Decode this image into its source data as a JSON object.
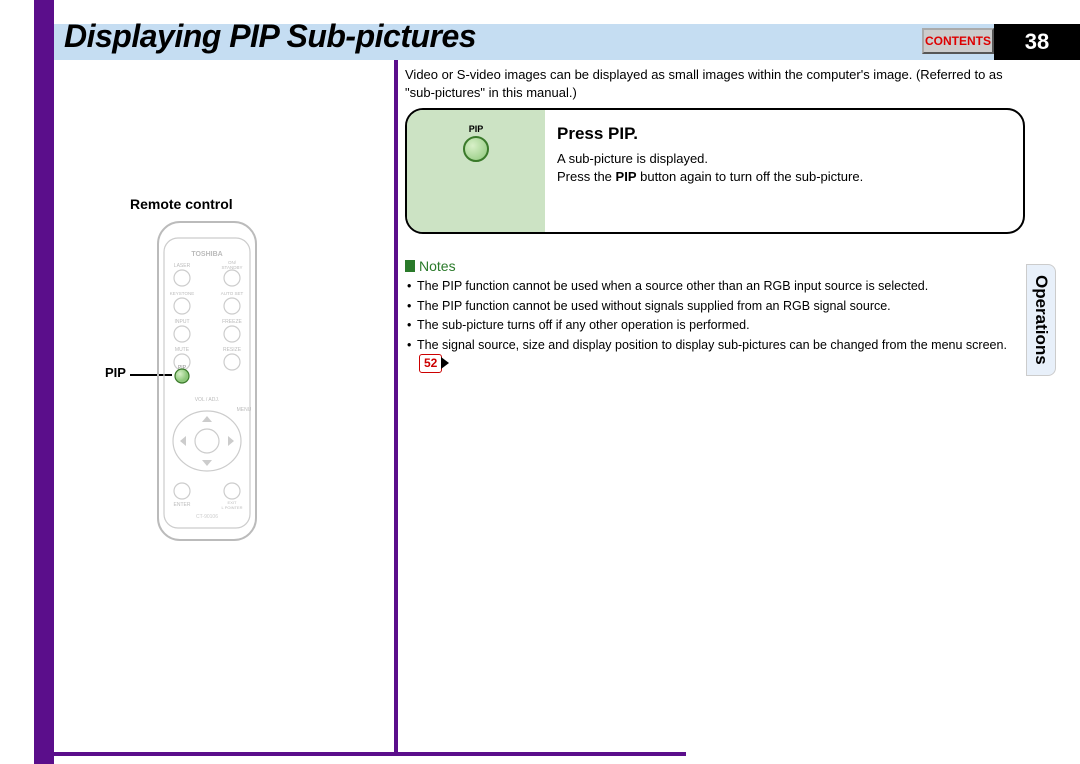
{
  "header": {
    "title": "Displaying PIP Sub-pictures",
    "contents_button": "CONTENTS",
    "page_number": "38"
  },
  "intro": "Video or S-video images can be displayed as small images within the computer's image. (Referred to as \"sub-pictures\" in this manual.)",
  "instruction": {
    "button_label": "PIP",
    "heading": "Press PIP.",
    "line1": "A sub-picture is displayed.",
    "line2_pre": "Press the ",
    "line2_bold": "PIP",
    "line2_post": " button again to turn off the sub-picture."
  },
  "notes": {
    "header": "Notes",
    "items": [
      "The PIP function cannot be used when a source other than an RGB input source is selected.",
      "The PIP function cannot be used without signals supplied from an RGB signal source.",
      "The sub-picture turns off if any other operation is performed.",
      "The signal source, size and display position to display sub-pictures can be changed from the menu screen."
    ],
    "page_ref": "52"
  },
  "side_tab": "Operations",
  "remote": {
    "label": "Remote control",
    "callout": "PIP",
    "brand": "TOSHIBA",
    "buttons": {
      "laser": "LASER",
      "on_standby": "ON/STANDBY",
      "keystone": "KEYSTONE",
      "auto_set": "AUTO SET",
      "input": "INPUT",
      "pip": "PIP",
      "freeze": "FREEZE",
      "mute": "MUTE",
      "resize": "RESIZE",
      "volume": "VOL/ADJ",
      "menu": "MENU",
      "enter": "ENTER",
      "exit": "EXIT/L-POINTER",
      "model": "CT-90106"
    }
  }
}
